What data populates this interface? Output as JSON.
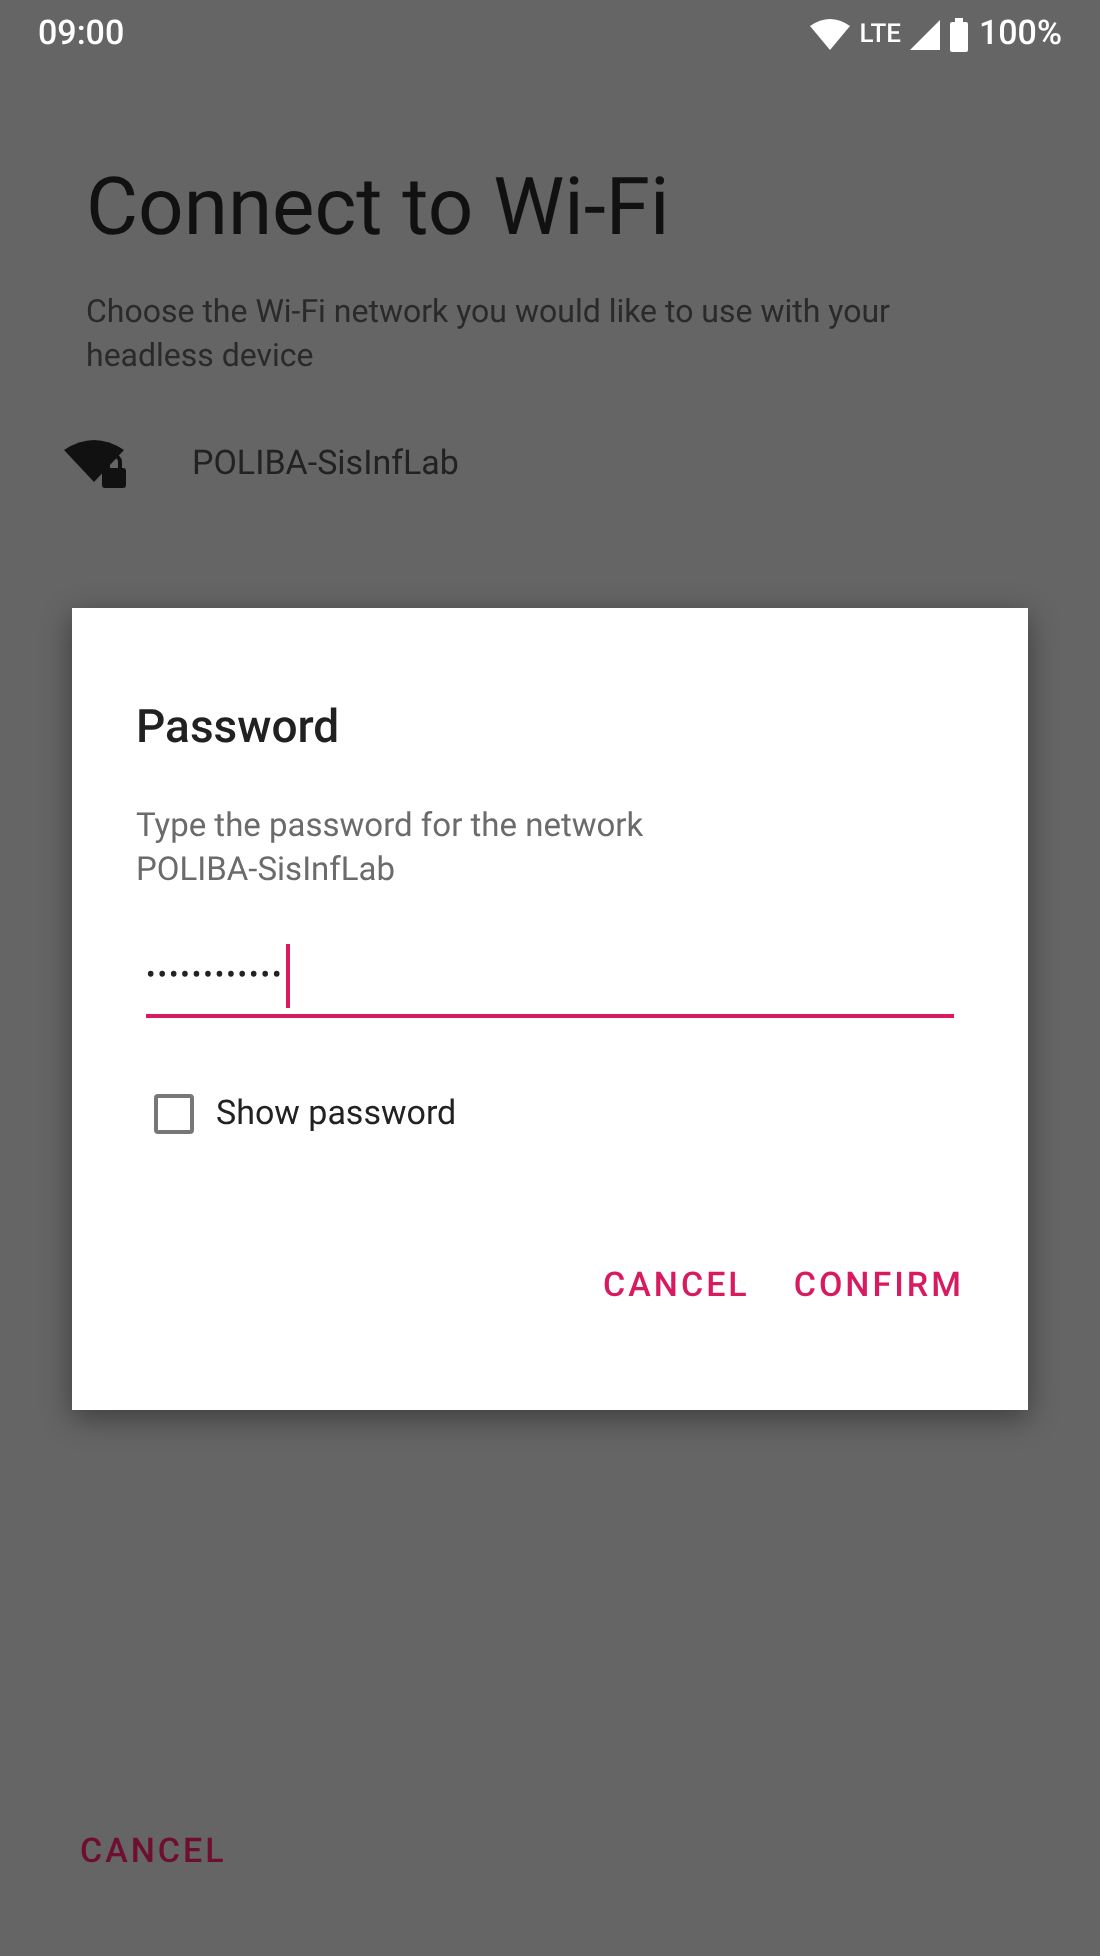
{
  "status_bar": {
    "time": "09:00",
    "network": "LTE",
    "battery": "100%"
  },
  "title": "Connect to Wi-Fi",
  "subtitle": "Choose the Wi-Fi network you would like to use with your headless device",
  "networks": [
    {
      "name": "POLIBA-SisInfLab",
      "secured": true
    }
  ],
  "dialog": {
    "title": "Password",
    "message": "Type the password for the network POLIBA-SisInfLab",
    "password": {
      "value": "••••••••••••",
      "focused": true
    },
    "show_password": {
      "label": "Show password",
      "checked": false
    },
    "buttons": [
      "CANCEL",
      "CONFIRM"
    ]
  },
  "footer_button": "CANCEL"
}
